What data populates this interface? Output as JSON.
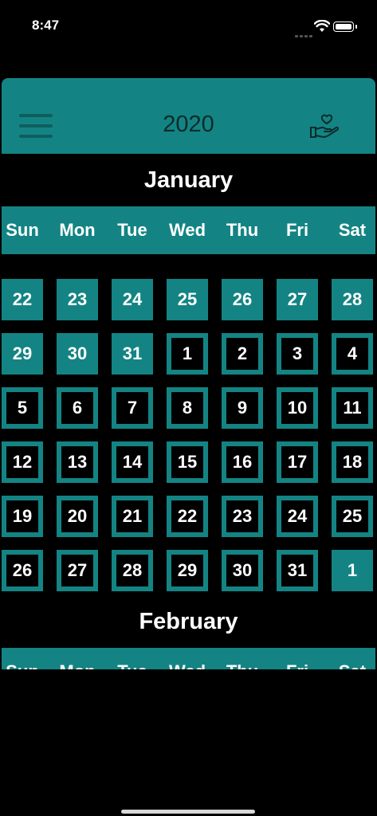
{
  "status": {
    "time": "8:47"
  },
  "header": {
    "title": "2020"
  },
  "january": {
    "title": "January",
    "weekdays": [
      "Sun",
      "Mon",
      "Tue",
      "Wed",
      "Thu",
      "Fri",
      "Sat"
    ],
    "weeks": [
      [
        "22",
        "23",
        "24",
        "25",
        "26",
        "27",
        "28"
      ],
      [
        "29",
        "30",
        "31",
        "1",
        "2",
        "3",
        "4"
      ],
      [
        "5",
        "6",
        "7",
        "8",
        "9",
        "10",
        "11"
      ],
      [
        "12",
        "13",
        "14",
        "15",
        "16",
        "17",
        "18"
      ],
      [
        "19",
        "20",
        "21",
        "22",
        "23",
        "24",
        "25"
      ],
      [
        "26",
        "27",
        "28",
        "29",
        "30",
        "31",
        "1"
      ]
    ],
    "current_month_flags": [
      [
        false,
        false,
        false,
        false,
        false,
        false,
        false
      ],
      [
        false,
        false,
        false,
        true,
        true,
        true,
        true
      ],
      [
        true,
        true,
        true,
        true,
        true,
        true,
        true
      ],
      [
        true,
        true,
        true,
        true,
        true,
        true,
        true
      ],
      [
        true,
        true,
        true,
        true,
        true,
        true,
        true
      ],
      [
        true,
        true,
        true,
        true,
        true,
        true,
        false
      ]
    ]
  },
  "february": {
    "title": "February",
    "weekdays": [
      "Sun",
      "Mon",
      "Tue",
      "Wed",
      "Thu",
      "Fri",
      "Sat"
    ]
  },
  "colors": {
    "accent": "#138483",
    "background": "#000000",
    "text": "#ffffff",
    "title_dark": "#0c2b2b"
  }
}
